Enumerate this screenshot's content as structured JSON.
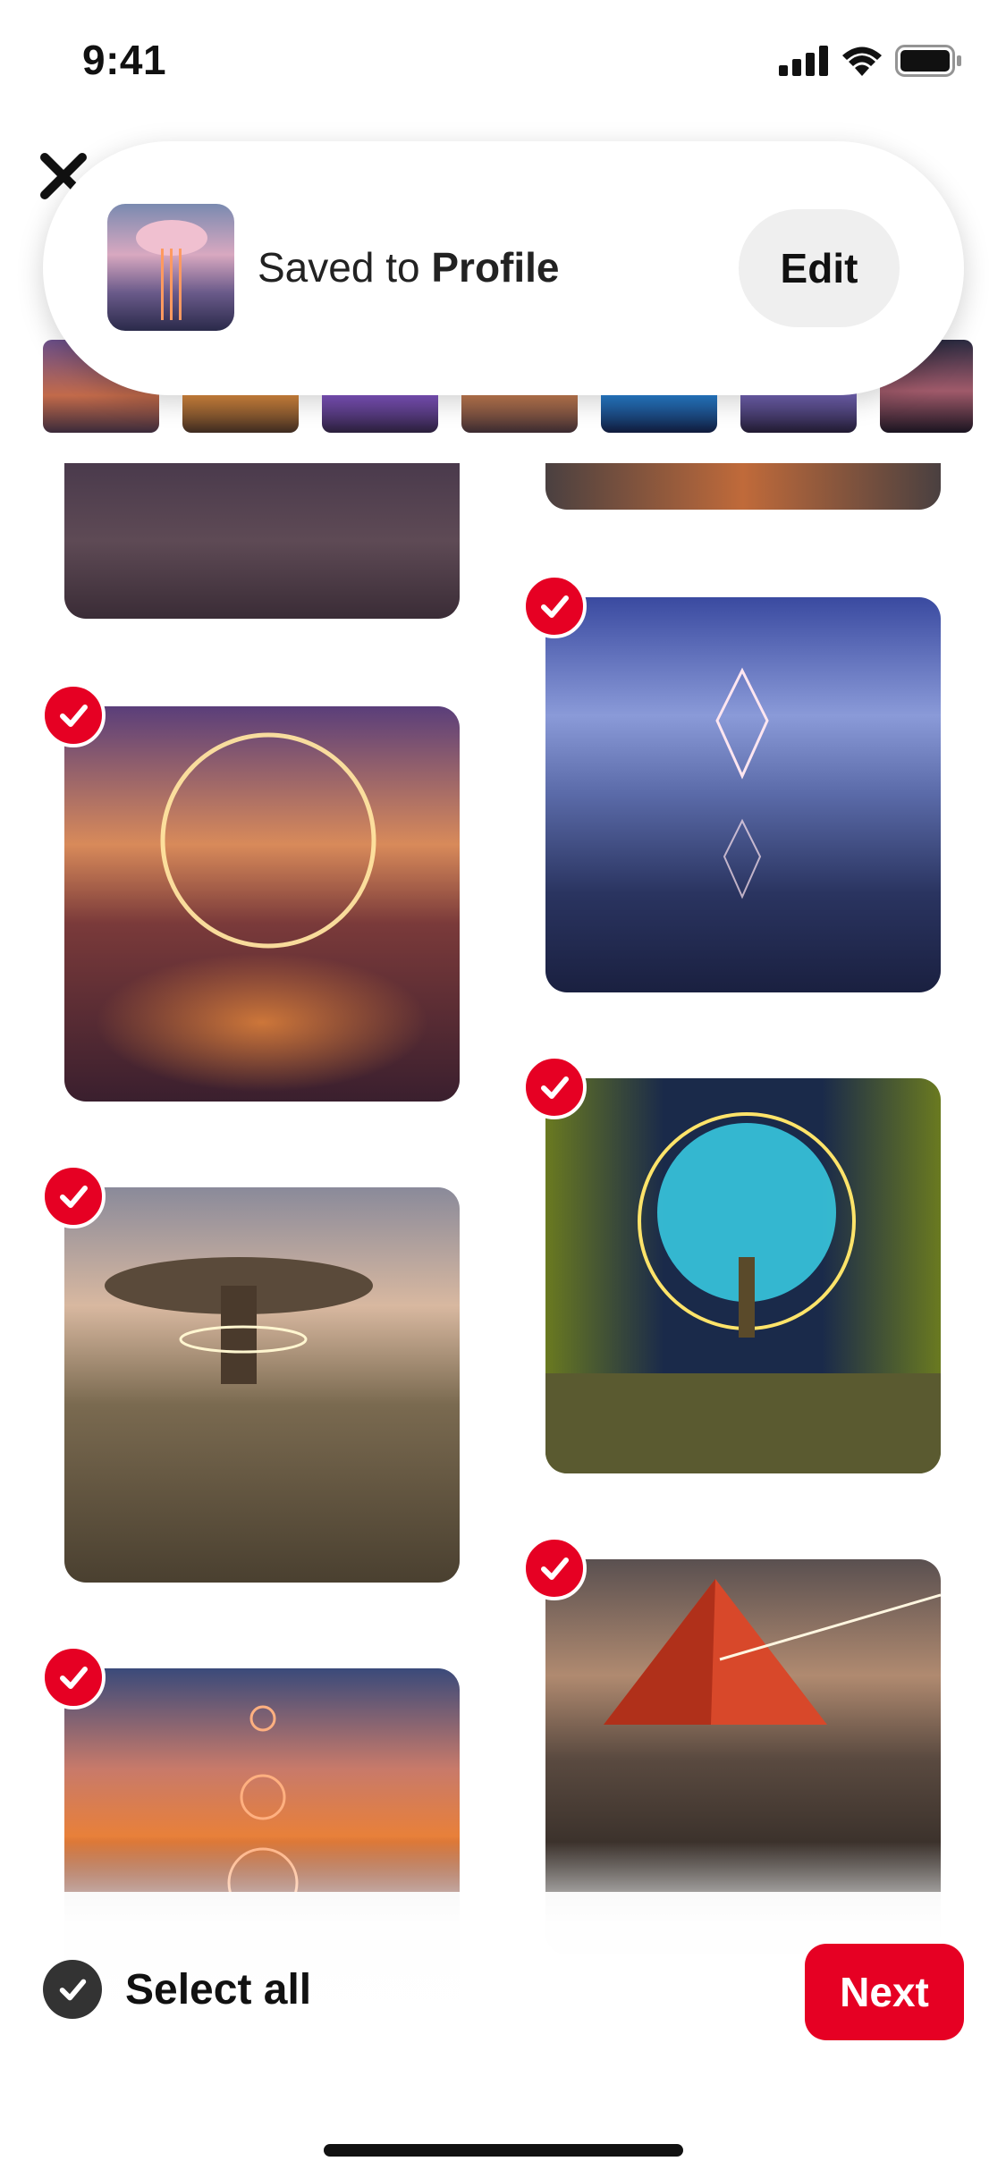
{
  "status_bar": {
    "time": "9:41"
  },
  "toast": {
    "prefix": "Saved to ",
    "destination": "Profile",
    "edit_label": "Edit"
  },
  "bottom_bar": {
    "select_all_label": "Select all",
    "next_label": "Next"
  },
  "colors": {
    "accent": "#e60023",
    "toast_bg": "#ffffff",
    "edit_bg": "#efefef",
    "select_circle": "#333333"
  },
  "icons": [
    "close-icon",
    "signal-icon",
    "wifi-icon",
    "battery-icon",
    "checkmark-icon"
  ]
}
